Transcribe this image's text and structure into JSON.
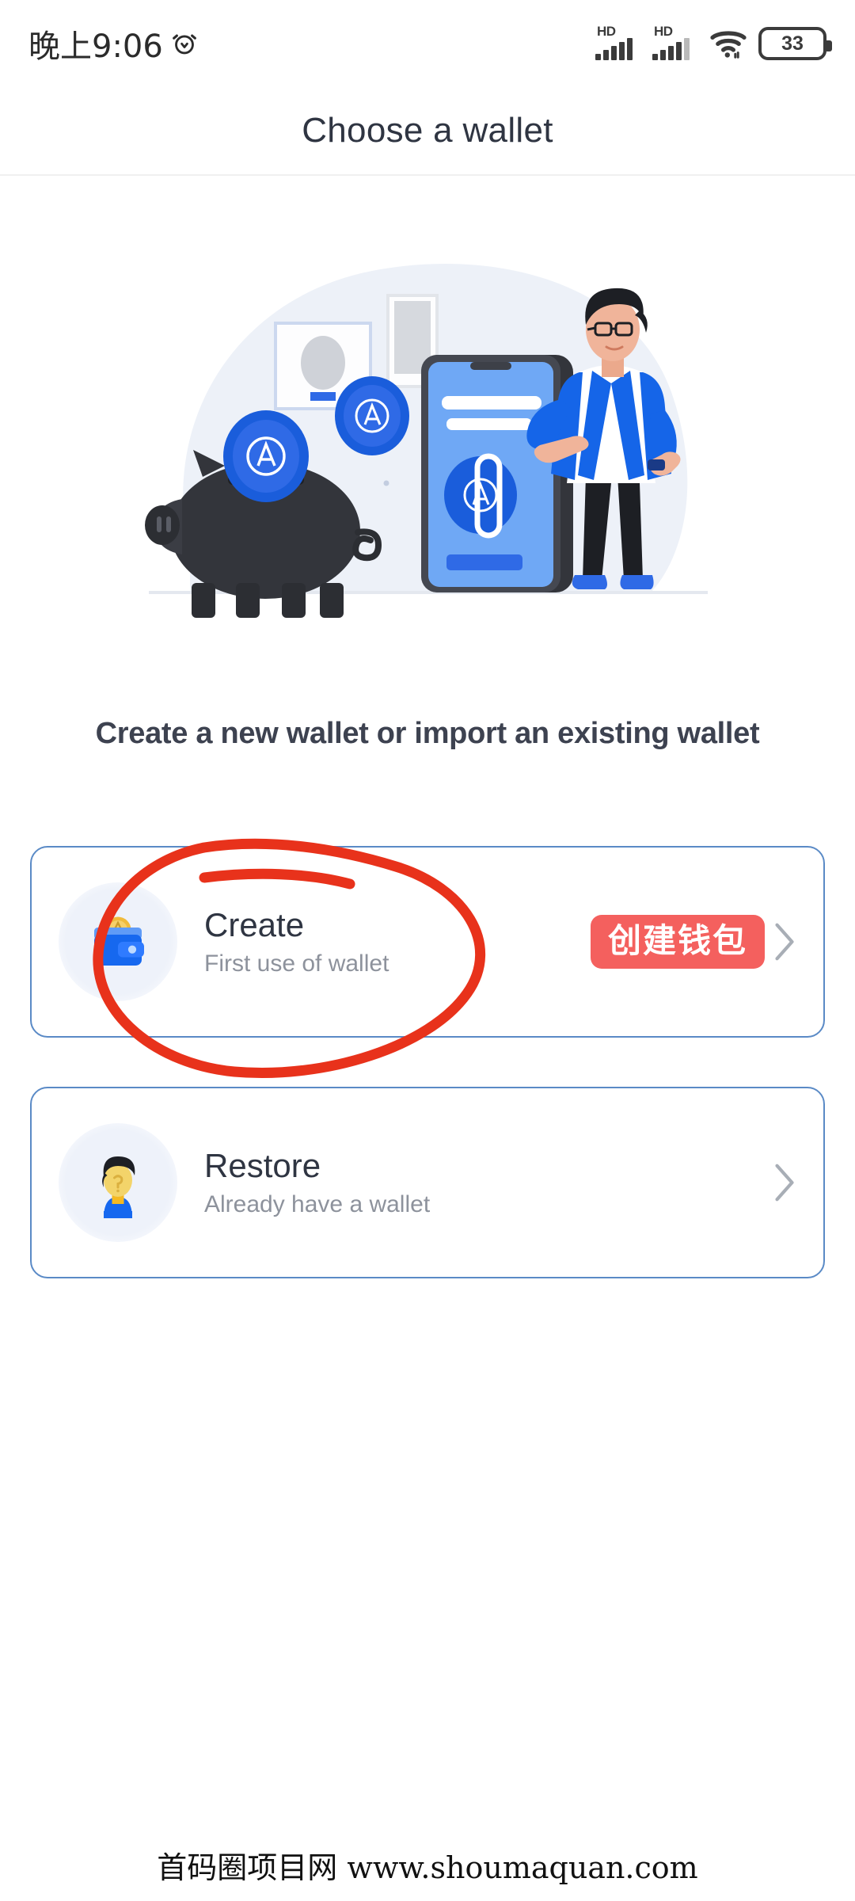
{
  "status_bar": {
    "time": "晚上9:06",
    "alarm_icon": "alarm-clock-icon",
    "signal_1_label": "HD",
    "signal_2_label": "HD",
    "wifi_icon": "wifi-icon",
    "battery_level": "33"
  },
  "header": {
    "title": "Choose a wallet"
  },
  "illustration": {
    "name": "wallet-onboarding-illustration",
    "description": "piggy bank with coins, smartphone and standing man",
    "blob_color": "#edf1f8",
    "coin_color": "#1f5fe0",
    "phone_screen_color": "#6fa8f5",
    "shirt_color": "#1565e8"
  },
  "subtitle": "Create a new wallet or import an existing wallet",
  "options": [
    {
      "icon": "wallet-icon",
      "title": "Create",
      "subtitle": "First use of wallet",
      "badge": "创建钱包",
      "badge_color": "#f4605e",
      "has_chevron": true
    },
    {
      "icon": "user-avatar-icon",
      "title": "Restore",
      "subtitle": "Already have a wallet",
      "badge": "",
      "badge_color": "",
      "has_chevron": true
    }
  ],
  "annotation": {
    "name": "red-circle-highlight",
    "color": "#e8321b",
    "target": "Create"
  },
  "footer": {
    "watermark": "首码圈项目网 www.shoumaquan.com"
  },
  "theme": {
    "card_border": "#5a8ac6",
    "title_color": "#2f3542",
    "muted_color": "#8d929c",
    "background": "#ffffff"
  }
}
